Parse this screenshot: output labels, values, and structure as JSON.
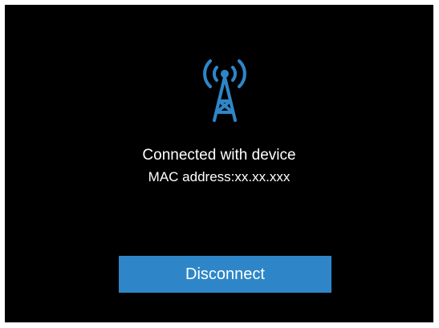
{
  "status": {
    "title": "Connected with device",
    "mac_label": "MAC address:xx.xx.xxx",
    "icon": "antenna-signal-icon"
  },
  "actions": {
    "disconnect_label": "Disconnect"
  },
  "colors": {
    "background": "#000000",
    "accent": "#2e86c8",
    "text": "#ffffff"
  }
}
